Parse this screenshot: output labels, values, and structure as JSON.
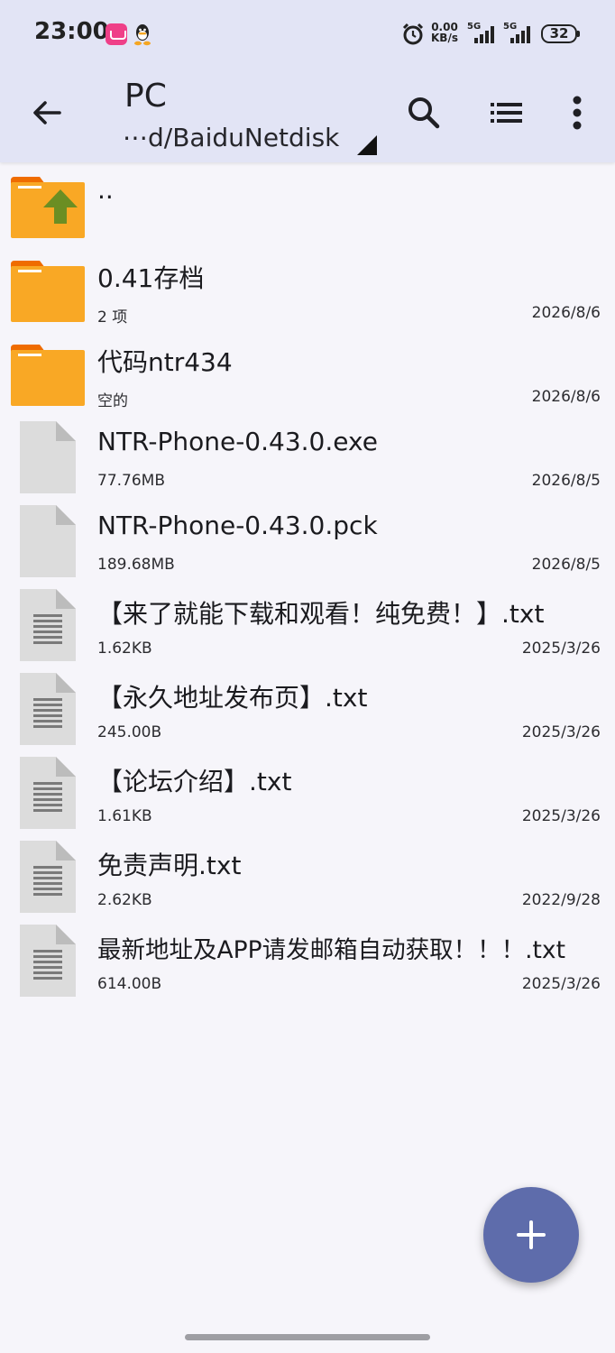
{
  "status_bar": {
    "time": "23:00",
    "net_speed_value": "0.00",
    "net_speed_unit": "KB/s",
    "sim1_label": "5G",
    "sim2_label": "5G",
    "battery": "32",
    "icons": [
      "app-icon",
      "qq-icon",
      "alarm-icon",
      "signal-icon",
      "signal-icon",
      "battery-icon"
    ]
  },
  "toolbar": {
    "title": "PC",
    "path": "⋯d/BaiduNetdisk",
    "icons": [
      "back-arrow-icon",
      "search-icon",
      "list-view-icon",
      "more-vert-icon"
    ]
  },
  "files": [
    {
      "name": "..",
      "meta": "",
      "date": "",
      "kind": "parent-folder"
    },
    {
      "name": "0.41存档",
      "meta": "2 项",
      "date": "2026/8/6",
      "kind": "folder"
    },
    {
      "name": "代码ntr434",
      "meta": "空的",
      "date": "2026/8/6",
      "kind": "folder"
    },
    {
      "name": "NTR-Phone-0.43.0.exe",
      "meta": "77.76MB",
      "date": "2026/8/5",
      "kind": "file"
    },
    {
      "name": "NTR-Phone-0.43.0.pck",
      "meta": "189.68MB",
      "date": "2026/8/5",
      "kind": "file"
    },
    {
      "name": "【来了就能下载和观看！纯免费！】.txt",
      "meta": "1.62KB",
      "date": "2025/3/26",
      "kind": "text"
    },
    {
      "name": "【永久地址发布页】.txt",
      "meta": "245.00B",
      "date": "2025/3/26",
      "kind": "text"
    },
    {
      "name": "【论坛介绍】.txt",
      "meta": "1.61KB",
      "date": "2025/3/26",
      "kind": "text"
    },
    {
      "name": "免责声明.txt",
      "meta": "2.62KB",
      "date": "2022/9/28",
      "kind": "text"
    },
    {
      "name": "最新地址及APP请发邮箱自动获取！！！.txt",
      "meta": "614.00B",
      "date": "2025/3/26",
      "kind": "text"
    }
  ],
  "fab": {
    "icon": "plus-icon"
  },
  "colors": {
    "toolbar_bg": "#e2e4f5",
    "page_bg": "#f6f5fa",
    "folder": "#f9a825",
    "folder_tab": "#ef6c00",
    "up_arrow": "#6b8e23",
    "fab": "#5e6cab"
  }
}
